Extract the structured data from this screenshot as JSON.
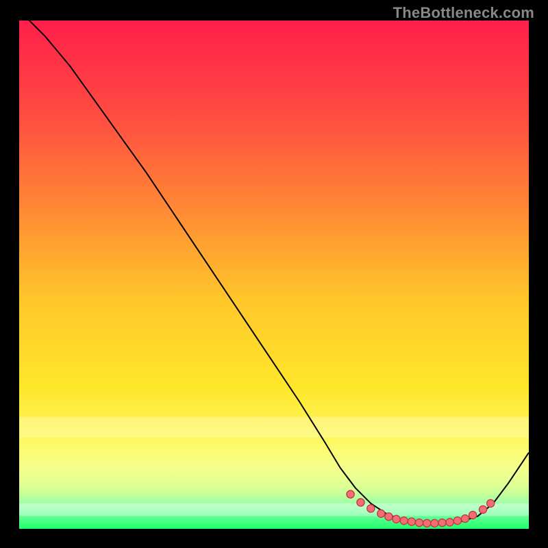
{
  "attribution": "TheBottleneck.com",
  "colors": {
    "background": "#000000",
    "attribution_text": "#8a8787",
    "curve": "#000000",
    "marker": "#f56d74",
    "glow": "#ffffff"
  },
  "chart_data": {
    "type": "line",
    "title": "",
    "xlabel": "",
    "ylabel": "",
    "xlim": [
      0,
      100
    ],
    "ylim": [
      0,
      100
    ],
    "grid": false,
    "series": [
      {
        "name": "curve",
        "x": [
          0,
          5,
          10,
          15,
          20,
          25,
          30,
          35,
          40,
          45,
          50,
          55,
          60,
          63,
          66,
          69,
          72,
          75,
          78,
          81,
          84,
          87,
          90,
          93,
          96,
          100
        ],
        "y": [
          102,
          97,
          91,
          84,
          77,
          70,
          62.5,
          55,
          47.5,
          40,
          32.5,
          25,
          17,
          12,
          8,
          5,
          3,
          1.8,
          1.2,
          1,
          1,
          1.5,
          2.5,
          5,
          9,
          15
        ]
      }
    ],
    "markers": {
      "name": "highlight-region",
      "x": [
        65,
        67,
        69,
        71,
        72.5,
        74,
        75.5,
        77,
        78.5,
        80,
        81.5,
        83,
        84.5,
        86,
        87.5,
        89,
        91,
        92.5
      ],
      "y": [
        6.8,
        5.2,
        4.0,
        3.0,
        2.4,
        1.9,
        1.6,
        1.4,
        1.2,
        1.1,
        1.1,
        1.2,
        1.3,
        1.6,
        2.0,
        2.7,
        3.8,
        5.0
      ]
    },
    "gradient": {
      "direction": "vertical",
      "stops": [
        {
          "offset": 0.0,
          "color": "#ff1f4a"
        },
        {
          "offset": 0.18,
          "color": "#ff4a42"
        },
        {
          "offset": 0.35,
          "color": "#ff8236"
        },
        {
          "offset": 0.55,
          "color": "#ffc72a"
        },
        {
          "offset": 0.72,
          "color": "#ffe62a"
        },
        {
          "offset": 0.82,
          "color": "#fdf85e"
        },
        {
          "offset": 0.88,
          "color": "#f6ff8d"
        },
        {
          "offset": 0.92,
          "color": "#d9ff94"
        },
        {
          "offset": 0.96,
          "color": "#8dffab"
        },
        {
          "offset": 1.0,
          "color": "#1eff6d"
        }
      ]
    }
  }
}
